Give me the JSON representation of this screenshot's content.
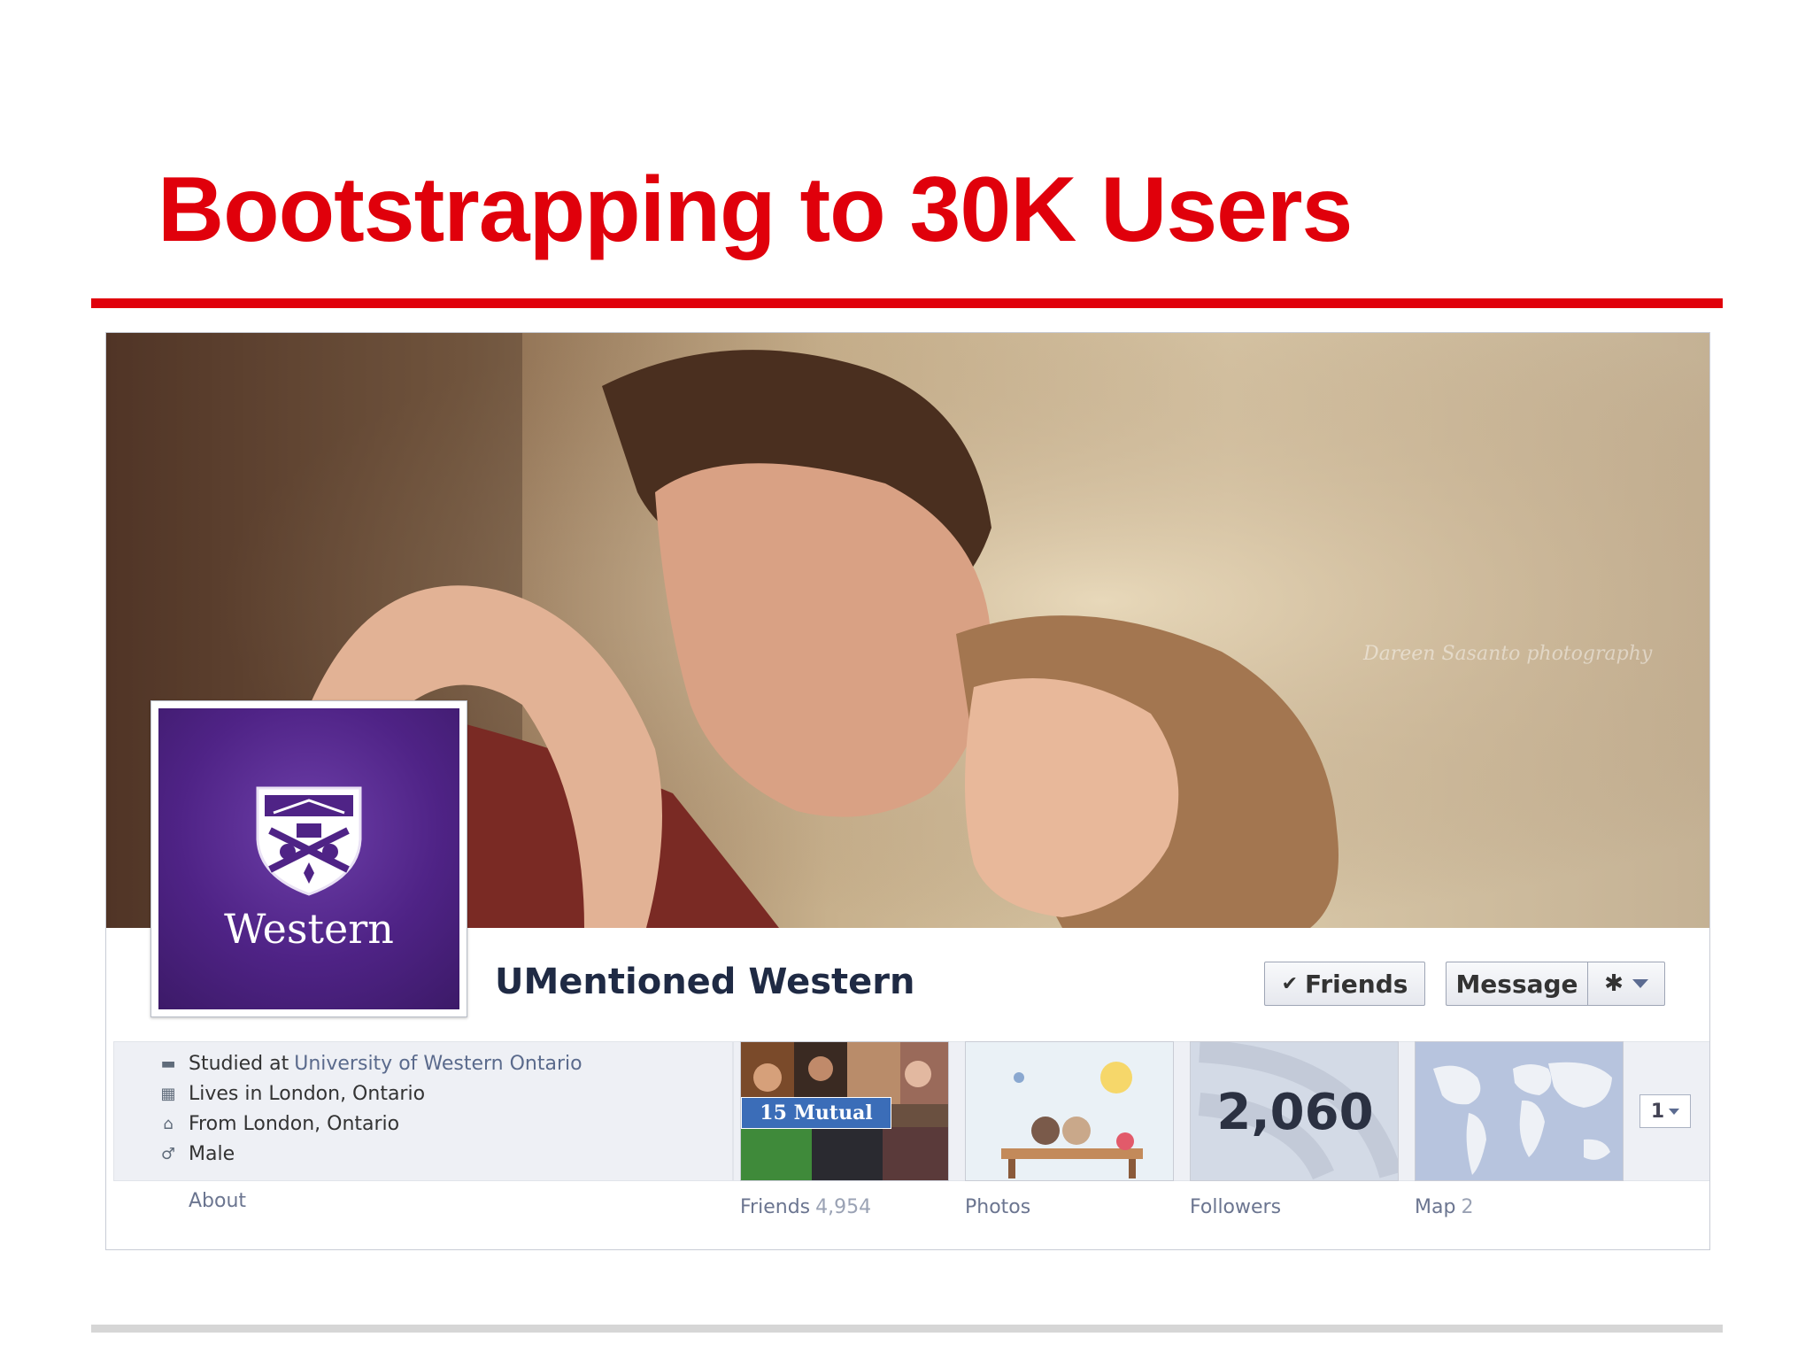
{
  "slide": {
    "title": "Bootstrapping to 30K Users"
  },
  "profile": {
    "cover_watermark": "Dareen Sasanto photography",
    "avatar_text": "Western",
    "name": "UMentioned Western",
    "buttons": {
      "friends": "Friends",
      "message": "Message"
    },
    "info": {
      "studied_prefix": "Studied at",
      "studied_link": "University of Western Ontario",
      "lives": "Lives in London, Ontario",
      "from": "From London, Ontario",
      "gender": "Male"
    },
    "about_label": "About",
    "tiles": {
      "friends_label": "Friends",
      "friends_count": "4,954",
      "mutual_badge": "15 Mutual",
      "photos_label": "Photos",
      "followers_value": "2,060",
      "followers_label": "Followers",
      "map_label": "Map",
      "map_count": "2"
    },
    "more_count": "1"
  },
  "colors": {
    "title_red": "#e0000b",
    "western_purple": "#4f2386",
    "facebook_blue": "#3b6db8"
  },
  "icons": [
    "check-icon",
    "gear-icon",
    "chevron-down-icon",
    "graduation-icon",
    "city-icon",
    "house-icon",
    "male-icon",
    "university-crest-icon"
  ]
}
